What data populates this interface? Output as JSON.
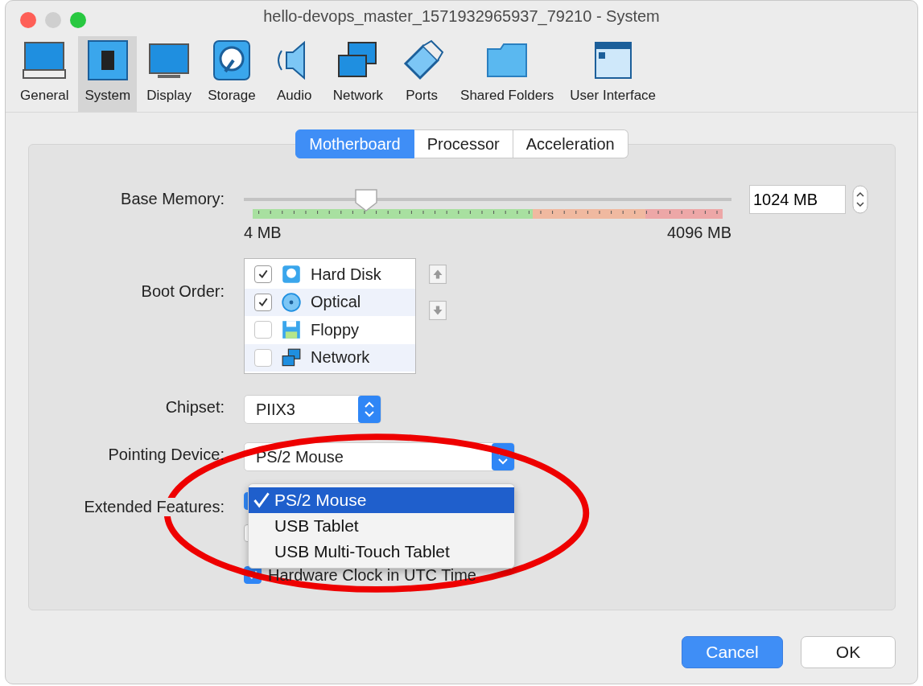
{
  "window": {
    "title": "hello-devops_master_1571932965937_79210 - System"
  },
  "toolbar": [
    {
      "label": "General",
      "selected": false
    },
    {
      "label": "System",
      "selected": true
    },
    {
      "label": "Display",
      "selected": false
    },
    {
      "label": "Storage",
      "selected": false
    },
    {
      "label": "Audio",
      "selected": false
    },
    {
      "label": "Network",
      "selected": false
    },
    {
      "label": "Ports",
      "selected": false
    },
    {
      "label": "Shared Folders",
      "selected": false
    },
    {
      "label": "User Interface",
      "selected": false
    }
  ],
  "tabs": [
    {
      "label": "Motherboard",
      "selected": true
    },
    {
      "label": "Processor",
      "selected": false
    },
    {
      "label": "Acceleration",
      "selected": false
    }
  ],
  "base_memory": {
    "label": "Base Memory:",
    "level": 0.25,
    "min_label": "4 MB",
    "max_label": "4096 MB",
    "value": "1024 MB"
  },
  "boot_order": {
    "label": "Boot Order:",
    "items": [
      {
        "label": "Hard Disk",
        "checked": true
      },
      {
        "label": "Optical",
        "checked": true
      },
      {
        "label": "Floppy",
        "checked": false
      },
      {
        "label": "Network",
        "checked": false
      }
    ]
  },
  "chipset": {
    "label": "Chipset:",
    "value": "PIIX3"
  },
  "pointing_device": {
    "label": "Pointing Device:",
    "value": "PS/2 Mouse",
    "menu": [
      {
        "label": "PS/2 Mouse",
        "selected": true
      },
      {
        "label": "USB Tablet",
        "selected": false
      },
      {
        "label": "USB Multi-Touch Tablet",
        "selected": false
      }
    ]
  },
  "extended_features": {
    "label": "Extended Features:",
    "items": [
      {
        "checked": true
      },
      {
        "checked": false
      },
      {
        "label": "Hardware Clock in UTC Time",
        "checked": true
      }
    ]
  },
  "buttons": [
    {
      "label": "Cancel",
      "default": true
    },
    {
      "label": "OK",
      "default": false
    }
  ]
}
